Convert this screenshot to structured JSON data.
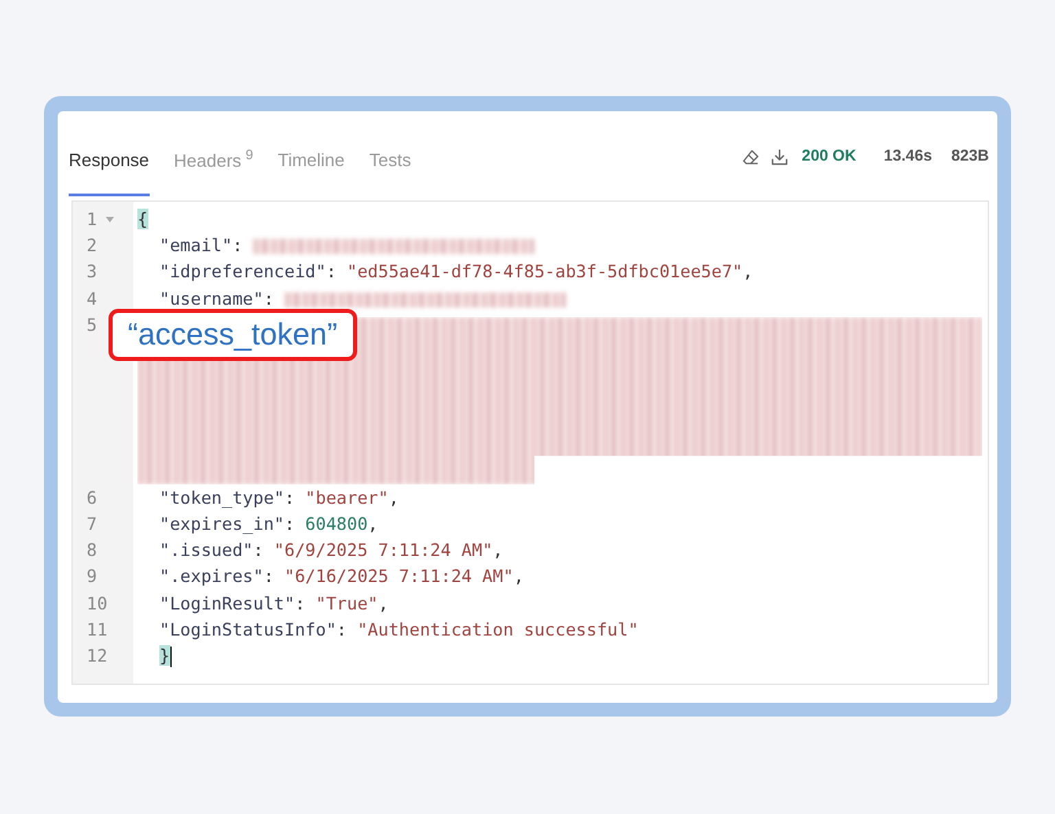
{
  "tabs": [
    {
      "label": "Response",
      "selected": true
    },
    {
      "label": "Headers",
      "badge": "9",
      "selected": false
    },
    {
      "label": "Timeline",
      "selected": false
    },
    {
      "label": "Tests",
      "selected": false
    }
  ],
  "status": {
    "code": "200 OK",
    "time": "13.46s",
    "size": "823B"
  },
  "editor": {
    "lines": [
      {
        "number": "1",
        "fold": true,
        "tokens": [
          {
            "kind": "brace",
            "text": "{",
            "highlighted": true
          }
        ]
      },
      {
        "number": "2",
        "tokens": [
          {
            "kind": "key",
            "text": "\"email\""
          },
          {
            "kind": "punct",
            "text": ": "
          },
          {
            "kind": "blurred"
          }
        ]
      },
      {
        "number": "3",
        "tokens": [
          {
            "kind": "key",
            "text": "\"idpreferenceid\""
          },
          {
            "kind": "punct",
            "text": ": "
          },
          {
            "kind": "string",
            "text": "\"ed55ae41-df78-4f85-ab3f-5dfbc01ee5e7\""
          },
          {
            "kind": "punct",
            "text": ","
          }
        ]
      },
      {
        "number": "4",
        "tokens": [
          {
            "kind": "key",
            "text": "\"username\""
          },
          {
            "kind": "punct",
            "text": ": "
          },
          {
            "kind": "blurred"
          }
        ]
      },
      {
        "number": "5",
        "tokens": [
          {
            "kind": "blurblock"
          }
        ]
      },
      {
        "number": "6",
        "tokens": [
          {
            "kind": "key",
            "text": "\"token_type\""
          },
          {
            "kind": "punct",
            "text": ": "
          },
          {
            "kind": "string",
            "text": "\"bearer\""
          },
          {
            "kind": "punct",
            "text": ","
          }
        ]
      },
      {
        "number": "7",
        "tokens": [
          {
            "kind": "key",
            "text": "\"expires_in\""
          },
          {
            "kind": "punct",
            "text": ": "
          },
          {
            "kind": "number",
            "text": "604800"
          },
          {
            "kind": "punct",
            "text": ","
          }
        ]
      },
      {
        "number": "8",
        "tokens": [
          {
            "kind": "key",
            "text": "\".issued\""
          },
          {
            "kind": "punct",
            "text": ": "
          },
          {
            "kind": "string",
            "text": "\"6/9/2025 7:11:24 AM\""
          },
          {
            "kind": "punct",
            "text": ","
          }
        ]
      },
      {
        "number": "9",
        "tokens": [
          {
            "kind": "key",
            "text": "\".expires\""
          },
          {
            "kind": "punct",
            "text": ": "
          },
          {
            "kind": "string",
            "text": "\"6/16/2025 7:11:24 AM\""
          },
          {
            "kind": "punct",
            "text": ","
          }
        ]
      },
      {
        "number": "10",
        "tokens": [
          {
            "kind": "key",
            "text": "\"LoginResult\""
          },
          {
            "kind": "punct",
            "text": ": "
          },
          {
            "kind": "string",
            "text": "\"True\""
          },
          {
            "kind": "punct",
            "text": ","
          }
        ]
      },
      {
        "number": "11",
        "tokens": [
          {
            "kind": "key",
            "text": "\"LoginStatusInfo\""
          },
          {
            "kind": "punct",
            "text": ": "
          },
          {
            "kind": "string",
            "text": "\"Authentication successful\""
          }
        ]
      },
      {
        "number": "12",
        "cursor": true,
        "tokens": [
          {
            "kind": "brace",
            "text": "}",
            "highlighted": true
          }
        ]
      }
    ]
  },
  "callout": {
    "text": "“access_token”"
  }
}
